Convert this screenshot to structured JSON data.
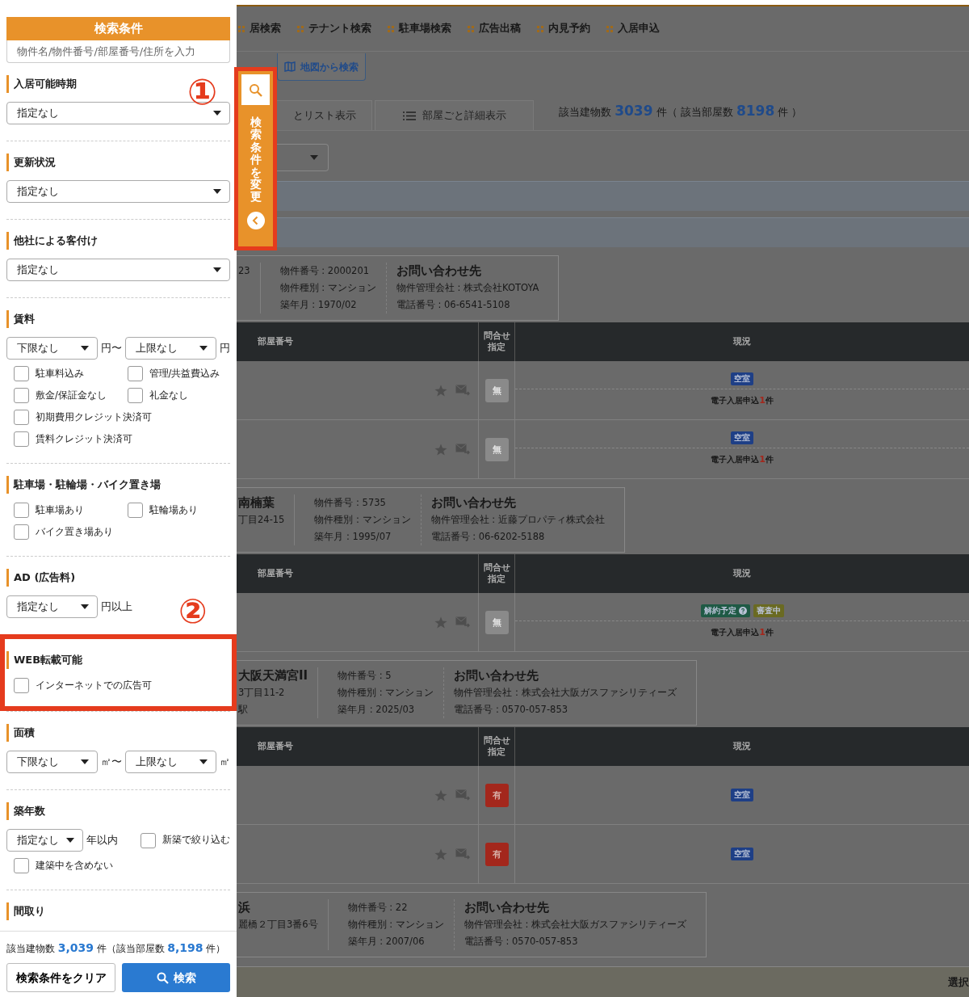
{
  "sidebar": {
    "title": "検索条件",
    "search_placeholder": "物件名/物件番号/部屋番号/住所を入力",
    "sections": [
      {
        "label": "入居可能時期",
        "highlighted": false,
        "rows": [
          [
            {
              "kind": "select",
              "value": "指定なし"
            }
          ]
        ]
      },
      {
        "label": "更新状況",
        "highlighted": false,
        "rows": [
          [
            {
              "kind": "select",
              "value": "指定なし"
            }
          ]
        ]
      },
      {
        "label": "他社による客付け",
        "highlighted": false,
        "rows": [
          [
            {
              "kind": "select",
              "value": "指定なし"
            }
          ]
        ]
      },
      {
        "label": "賃料",
        "highlighted": false,
        "rows": [
          [
            {
              "kind": "select",
              "value": "下限なし"
            },
            {
              "kind": "unit",
              "text": "円〜"
            },
            {
              "kind": "select",
              "value": "上限なし"
            },
            {
              "kind": "unit",
              "text": "円"
            }
          ],
          [
            {
              "kind": "checkbox",
              "label": "駐車料込み",
              "checked": false
            },
            {
              "kind": "checkbox",
              "label": "管理/共益費込み",
              "checked": false
            }
          ],
          [
            {
              "kind": "checkbox",
              "label": "敷金/保証金なし",
              "checked": false
            },
            {
              "kind": "checkbox",
              "label": "礼金なし",
              "checked": false
            }
          ],
          [
            {
              "kind": "checkbox",
              "label": "初期費用クレジット決済可",
              "checked": false
            }
          ],
          [
            {
              "kind": "checkbox",
              "label": "賃料クレジット決済可",
              "checked": false
            }
          ]
        ]
      },
      {
        "label": "駐車場・駐輪場・バイク置き場",
        "highlighted": false,
        "rows": [
          [
            {
              "kind": "checkbox",
              "label": "駐車場あり",
              "checked": false
            },
            {
              "kind": "checkbox",
              "label": "駐輪場あり",
              "checked": false
            }
          ],
          [
            {
              "kind": "checkbox",
              "label": "バイク置き場あり",
              "checked": false
            }
          ]
        ]
      },
      {
        "label": "AD (広告料)",
        "highlighted": false,
        "rows": [
          [
            {
              "kind": "select",
              "value": "指定なし"
            },
            {
              "kind": "unit",
              "text": "円以上"
            }
          ]
        ]
      },
      {
        "label": "WEB転載可能",
        "highlighted": true,
        "rows": [
          [
            {
              "kind": "checkbox",
              "label": "インターネットでの広告可",
              "checked": false
            }
          ]
        ]
      },
      {
        "label": "面積",
        "highlighted": false,
        "rows": [
          [
            {
              "kind": "select",
              "value": "下限なし"
            },
            {
              "kind": "unit",
              "text": "㎡〜"
            },
            {
              "kind": "select",
              "value": "上限なし"
            },
            {
              "kind": "unit",
              "text": "㎡"
            }
          ]
        ]
      },
      {
        "label": "築年数",
        "highlighted": false,
        "rows": [
          [
            {
              "kind": "select",
              "value": "指定なし"
            },
            {
              "kind": "unit",
              "text": "年以内"
            },
            {
              "kind": "checkbox",
              "label": "新築で絞り込む",
              "checked": false
            }
          ],
          [
            {
              "kind": "checkbox",
              "label": "建築中を含めない",
              "checked": false
            }
          ]
        ]
      },
      {
        "label": "間取り",
        "highlighted": false
      }
    ],
    "count_parts": [
      {
        "text": "該当建物数",
        "emph": false
      },
      {
        "text": "3,039",
        "emph": true
      },
      {
        "text": "件（該当部屋数",
        "emph": false
      },
      {
        "text": "8,198",
        "emph": true
      },
      {
        "text": "件）",
        "emph": false
      }
    ],
    "clear_button": "検索条件をクリア",
    "search_button": "検索"
  },
  "floating_tab": {
    "label": "検索条件を変更",
    "highlighted": true
  },
  "annotations": [
    {
      "label": "①"
    },
    {
      "label": "②"
    }
  ],
  "main": {
    "nav": [
      "居検索",
      "テナント検索",
      "駐車場検索",
      "広告出稿",
      "内見予約",
      "入居申込"
    ],
    "map_button": "地図から検索",
    "view_tabs": [
      {
        "label": "とリスト表示",
        "kind": "plain",
        "selected": false
      },
      {
        "label": "部屋ごと詳細表示",
        "kind": "list",
        "selected": false
      }
    ],
    "count_parts": [
      {
        "text": "該当建物数",
        "emph": false
      },
      {
        "text": "3039",
        "emph": true
      },
      {
        "text": "件（ 該当部屋数",
        "emph": false
      },
      {
        "text": "8198",
        "emph": true
      },
      {
        "text": "件 ）",
        "emph": false
      }
    ],
    "buildings": [
      {
        "address_lines": [
          "23"
        ],
        "details": [
          "物件番号 : 2000201",
          "物件種別 : マンション",
          "築年月 : 1970/02"
        ],
        "contact_title": "お問い合わせ先",
        "contact_lines": [
          "物件管理会社 : 株式会社KOTOYA",
          "電話番号 : 06-6541-5108"
        ],
        "table": {
          "columns": [
            [
              "部屋番号"
            ],
            [
              "問合せ",
              "指定"
            ],
            [
              "現況"
            ]
          ],
          "rows": [
            {
              "inquiry": "無",
              "active": false,
              "statuses": [
                {
                  "label": "空室",
                  "color": "#1e3f86",
                  "help": false
                }
              ],
              "application": {
                "label": "電子入居申込",
                "count": "1",
                "unit": "件"
              }
            },
            {
              "inquiry": "無",
              "active": false,
              "statuses": [
                {
                  "label": "空室",
                  "color": "#1e3f86",
                  "help": false
                }
              ],
              "application": {
                "label": "電子入居申込",
                "count": "1",
                "unit": "件"
              }
            }
          ]
        }
      },
      {
        "name": "南楠葉",
        "address_lines": [
          "丁目24-15"
        ],
        "details": [
          "物件番号 : 5735",
          "物件種別 : マンション",
          "築年月 : 1995/07"
        ],
        "contact_title": "お問い合わせ先",
        "contact_lines": [
          "物件管理会社 : 近藤プロパティ株式会社",
          "電話番号 : 06-6202-5188"
        ],
        "table": {
          "columns": [
            [
              "部屋番号"
            ],
            [
              "問合せ",
              "指定"
            ],
            [
              "現況"
            ]
          ],
          "rows": [
            {
              "inquiry": "無",
              "active": false,
              "statuses": [
                {
                  "label": "解約予定",
                  "color": "#1f5a45",
                  "help": true
                },
                {
                  "label": "審査中",
                  "color": "#6a6a22",
                  "help": false
                }
              ],
              "application": {
                "label": "電子入居申込",
                "count": "1",
                "unit": "件"
              }
            }
          ]
        }
      },
      {
        "name": "大阪天満宮II",
        "address_lines": [
          "3丁目11-2",
          "駅"
        ],
        "details": [
          "物件番号 : 5",
          "物件種別 : マンション",
          "築年月 : 2025/03"
        ],
        "contact_title": "お問い合わせ先",
        "contact_lines": [
          "物件管理会社 : 株式会社大阪ガスファシリティーズ",
          "電話番号 : 0570-057-853"
        ],
        "table": {
          "columns": [
            [
              "部屋番号"
            ],
            [
              "問合せ",
              "指定"
            ],
            [
              "現況"
            ]
          ],
          "rows": [
            {
              "inquiry": "有",
              "active": true,
              "statuses": [
                {
                  "label": "空室",
                  "color": "#1e3f86",
                  "help": false
                }
              ]
            },
            {
              "inquiry": "有",
              "active": true,
              "statuses": [
                {
                  "label": "空室",
                  "color": "#1e3f86",
                  "help": false
                }
              ]
            }
          ]
        }
      },
      {
        "name": "浜",
        "address_lines": [
          "麗橋２丁目3番6号"
        ],
        "details": [
          "物件番号 : 22",
          "物件種別 : マンション",
          "築年月 : 2007/06"
        ],
        "contact_title": "お問い合わせ先",
        "contact_lines": [
          "物件管理会社 : 株式会社大阪ガスファシリティーズ",
          "電話番号 : 0570-057-853"
        ]
      }
    ],
    "footer": "選択"
  }
}
